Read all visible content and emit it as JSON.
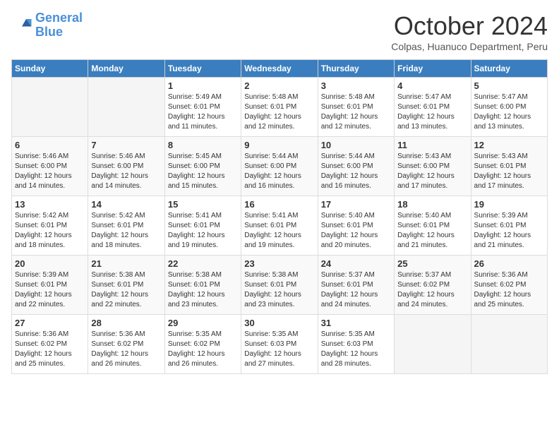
{
  "logo": {
    "line1": "General",
    "line2": "Blue"
  },
  "title": "October 2024",
  "location": "Colpas, Huanuco Department, Peru",
  "weekdays": [
    "Sunday",
    "Monday",
    "Tuesday",
    "Wednesday",
    "Thursday",
    "Friday",
    "Saturday"
  ],
  "weeks": [
    [
      {
        "day": "",
        "info": ""
      },
      {
        "day": "",
        "info": ""
      },
      {
        "day": "1",
        "info": "Sunrise: 5:49 AM\nSunset: 6:01 PM\nDaylight: 12 hours and 11 minutes."
      },
      {
        "day": "2",
        "info": "Sunrise: 5:48 AM\nSunset: 6:01 PM\nDaylight: 12 hours and 12 minutes."
      },
      {
        "day": "3",
        "info": "Sunrise: 5:48 AM\nSunset: 6:01 PM\nDaylight: 12 hours and 12 minutes."
      },
      {
        "day": "4",
        "info": "Sunrise: 5:47 AM\nSunset: 6:01 PM\nDaylight: 12 hours and 13 minutes."
      },
      {
        "day": "5",
        "info": "Sunrise: 5:47 AM\nSunset: 6:00 PM\nDaylight: 12 hours and 13 minutes."
      }
    ],
    [
      {
        "day": "6",
        "info": "Sunrise: 5:46 AM\nSunset: 6:00 PM\nDaylight: 12 hours and 14 minutes."
      },
      {
        "day": "7",
        "info": "Sunrise: 5:46 AM\nSunset: 6:00 PM\nDaylight: 12 hours and 14 minutes."
      },
      {
        "day": "8",
        "info": "Sunrise: 5:45 AM\nSunset: 6:00 PM\nDaylight: 12 hours and 15 minutes."
      },
      {
        "day": "9",
        "info": "Sunrise: 5:44 AM\nSunset: 6:00 PM\nDaylight: 12 hours and 16 minutes."
      },
      {
        "day": "10",
        "info": "Sunrise: 5:44 AM\nSunset: 6:00 PM\nDaylight: 12 hours and 16 minutes."
      },
      {
        "day": "11",
        "info": "Sunrise: 5:43 AM\nSunset: 6:00 PM\nDaylight: 12 hours and 17 minutes."
      },
      {
        "day": "12",
        "info": "Sunrise: 5:43 AM\nSunset: 6:01 PM\nDaylight: 12 hours and 17 minutes."
      }
    ],
    [
      {
        "day": "13",
        "info": "Sunrise: 5:42 AM\nSunset: 6:01 PM\nDaylight: 12 hours and 18 minutes."
      },
      {
        "day": "14",
        "info": "Sunrise: 5:42 AM\nSunset: 6:01 PM\nDaylight: 12 hours and 18 minutes."
      },
      {
        "day": "15",
        "info": "Sunrise: 5:41 AM\nSunset: 6:01 PM\nDaylight: 12 hours and 19 minutes."
      },
      {
        "day": "16",
        "info": "Sunrise: 5:41 AM\nSunset: 6:01 PM\nDaylight: 12 hours and 19 minutes."
      },
      {
        "day": "17",
        "info": "Sunrise: 5:40 AM\nSunset: 6:01 PM\nDaylight: 12 hours and 20 minutes."
      },
      {
        "day": "18",
        "info": "Sunrise: 5:40 AM\nSunset: 6:01 PM\nDaylight: 12 hours and 21 minutes."
      },
      {
        "day": "19",
        "info": "Sunrise: 5:39 AM\nSunset: 6:01 PM\nDaylight: 12 hours and 21 minutes."
      }
    ],
    [
      {
        "day": "20",
        "info": "Sunrise: 5:39 AM\nSunset: 6:01 PM\nDaylight: 12 hours and 22 minutes."
      },
      {
        "day": "21",
        "info": "Sunrise: 5:38 AM\nSunset: 6:01 PM\nDaylight: 12 hours and 22 minutes."
      },
      {
        "day": "22",
        "info": "Sunrise: 5:38 AM\nSunset: 6:01 PM\nDaylight: 12 hours and 23 minutes."
      },
      {
        "day": "23",
        "info": "Sunrise: 5:38 AM\nSunset: 6:01 PM\nDaylight: 12 hours and 23 minutes."
      },
      {
        "day": "24",
        "info": "Sunrise: 5:37 AM\nSunset: 6:01 PM\nDaylight: 12 hours and 24 minutes."
      },
      {
        "day": "25",
        "info": "Sunrise: 5:37 AM\nSunset: 6:02 PM\nDaylight: 12 hours and 24 minutes."
      },
      {
        "day": "26",
        "info": "Sunrise: 5:36 AM\nSunset: 6:02 PM\nDaylight: 12 hours and 25 minutes."
      }
    ],
    [
      {
        "day": "27",
        "info": "Sunrise: 5:36 AM\nSunset: 6:02 PM\nDaylight: 12 hours and 25 minutes."
      },
      {
        "day": "28",
        "info": "Sunrise: 5:36 AM\nSunset: 6:02 PM\nDaylight: 12 hours and 26 minutes."
      },
      {
        "day": "29",
        "info": "Sunrise: 5:35 AM\nSunset: 6:02 PM\nDaylight: 12 hours and 26 minutes."
      },
      {
        "day": "30",
        "info": "Sunrise: 5:35 AM\nSunset: 6:03 PM\nDaylight: 12 hours and 27 minutes."
      },
      {
        "day": "31",
        "info": "Sunrise: 5:35 AM\nSunset: 6:03 PM\nDaylight: 12 hours and 28 minutes."
      },
      {
        "day": "",
        "info": ""
      },
      {
        "day": "",
        "info": ""
      }
    ]
  ]
}
